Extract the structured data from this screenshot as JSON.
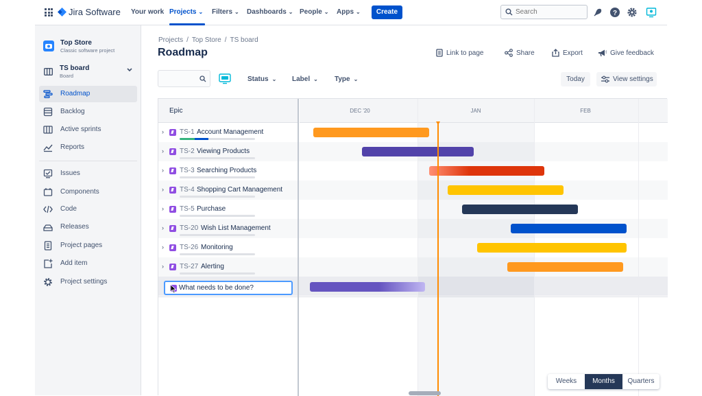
{
  "topnav": {
    "brand": "Jira Software",
    "items": [
      {
        "label": "Your work",
        "has_menu": false
      },
      {
        "label": "Projects",
        "has_menu": true,
        "active": true
      },
      {
        "label": "Filters",
        "has_menu": true
      },
      {
        "label": "Dashboards",
        "has_menu": true
      },
      {
        "label": "People",
        "has_menu": true
      },
      {
        "label": "Apps",
        "has_menu": true
      }
    ],
    "create_label": "Create",
    "search_placeholder": "Search",
    "icons": [
      "notifications-icon",
      "help-icon",
      "settings-icon",
      "profile-icon"
    ]
  },
  "sidebar": {
    "project_name": "Top Store",
    "project_type": "Classic software project",
    "board_name": "TS board",
    "board_type": "Board",
    "planning": [
      {
        "label": "Roadmap",
        "icon": "roadmap-icon",
        "active": true
      },
      {
        "label": "Backlog",
        "icon": "backlog-icon"
      },
      {
        "label": "Active sprints",
        "icon": "board-icon"
      },
      {
        "label": "Reports",
        "icon": "reports-icon"
      }
    ],
    "development": [
      {
        "label": "Issues",
        "icon": "issues-icon"
      },
      {
        "label": "Components",
        "icon": "components-icon"
      },
      {
        "label": "Code",
        "icon": "code-icon"
      },
      {
        "label": "Releases",
        "icon": "releases-icon"
      },
      {
        "label": "Project pages",
        "icon": "pages-icon"
      },
      {
        "label": "Add item",
        "icon": "add-item-icon"
      },
      {
        "label": "Project settings",
        "icon": "gear-icon"
      }
    ]
  },
  "breadcrumbs": [
    "Projects",
    "Top Store",
    "TS board"
  ],
  "page_title": "Roadmap",
  "header_actions": {
    "link": "Link to page",
    "share": "Share",
    "export": "Export",
    "feedback": "Give feedback"
  },
  "filters": {
    "search_value": "",
    "status": "Status",
    "label": "Label",
    "type": "Type",
    "today": "Today",
    "view_settings": "View settings"
  },
  "roadmap": {
    "epic_header": "Epic",
    "months": [
      "DEC '20",
      "JAN",
      "FEB"
    ],
    "epics": [
      {
        "key": "TS-1",
        "summary": "Account Management",
        "color": "#ff991f",
        "progress_done": 0.2,
        "progress_inprogress": 0.18
      },
      {
        "key": "TS-2",
        "summary": "Viewing Products",
        "color": "#5243aa",
        "progress_done": 0,
        "progress_inprogress": 0
      },
      {
        "key": "TS-3",
        "summary": "Searching Products",
        "color": "#de350b",
        "progress_done": 0,
        "progress_inprogress": 0
      },
      {
        "key": "TS-4",
        "summary": "Shopping Cart Management",
        "color": "#ffc400",
        "progress_done": 0,
        "progress_inprogress": 0
      },
      {
        "key": "TS-5",
        "summary": "Purchase",
        "color": "#253858",
        "progress_done": 0,
        "progress_inprogress": 0
      },
      {
        "key": "TS-20",
        "summary": "Wish List Management",
        "color": "#0052cc",
        "progress_done": 0,
        "progress_inprogress": 0
      },
      {
        "key": "TS-26",
        "summary": "Monitoring",
        "color": "#ffc400",
        "progress_done": 0,
        "progress_inprogress": 0
      },
      {
        "key": "TS-27",
        "summary": "Alerting",
        "color": "#ff991f",
        "progress_done": 0,
        "progress_inprogress": 0
      }
    ],
    "new_epic_value": "What needs to be done?",
    "new_bar_color": "#6554c0"
  },
  "timescale": {
    "options": [
      "Weeks",
      "Months",
      "Quarters"
    ],
    "selected": "Months"
  }
}
